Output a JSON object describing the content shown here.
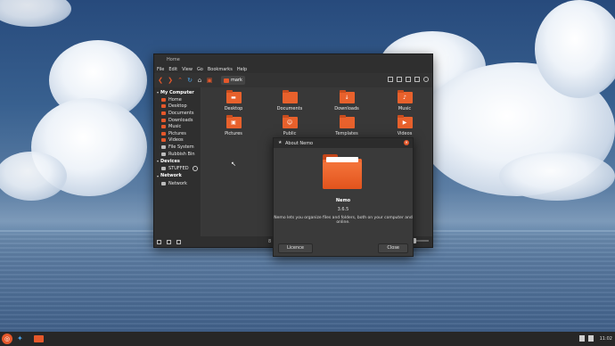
{
  "file_manager": {
    "title": "Home",
    "menu": [
      "File",
      "Edit",
      "View",
      "Go",
      "Bookmarks",
      "Help"
    ],
    "location": "mark",
    "sidebar": {
      "my_computer": "My Computer",
      "places": [
        {
          "label": "Home",
          "icon": "home-icon"
        },
        {
          "label": "Desktop",
          "icon": "folder-icon"
        },
        {
          "label": "Documents",
          "icon": "folder-icon"
        },
        {
          "label": "Downloads",
          "icon": "folder-icon"
        },
        {
          "label": "Music",
          "icon": "folder-icon"
        },
        {
          "label": "Pictures",
          "icon": "folder-icon"
        },
        {
          "label": "Videos",
          "icon": "folder-icon"
        },
        {
          "label": "File System",
          "icon": "drive-icon"
        },
        {
          "label": "Rubbish Bin",
          "icon": "trash-icon"
        }
      ],
      "devices": "Devices",
      "device_items": [
        {
          "label": "STUFFED",
          "icon": "drive-icon"
        }
      ],
      "network": "Network",
      "network_items": [
        {
          "label": "Network",
          "icon": "network-icon"
        }
      ]
    },
    "files": [
      {
        "label": "Desktop",
        "glyph": "▬"
      },
      {
        "label": "Documents",
        "glyph": ""
      },
      {
        "label": "Downloads",
        "glyph": "↓"
      },
      {
        "label": "Music",
        "glyph": "♪"
      },
      {
        "label": "Pictures",
        "glyph": "▣"
      },
      {
        "label": "Public",
        "glyph": "☺"
      },
      {
        "label": "Templates",
        "glyph": ""
      },
      {
        "label": "Videos",
        "glyph": "▶"
      }
    ],
    "status": "8"
  },
  "about_dialog": {
    "title": "About Nemo",
    "app_name": "Nemo",
    "version": "3.6.5",
    "description": "Nemo lets you organize files and folders, both on your computer and online.",
    "license_button": "Licence",
    "close_button": "Close"
  },
  "panel": {
    "clock": "11:02"
  },
  "colors": {
    "accent": "#e5582b",
    "window_bg": "#3a3a3a"
  }
}
